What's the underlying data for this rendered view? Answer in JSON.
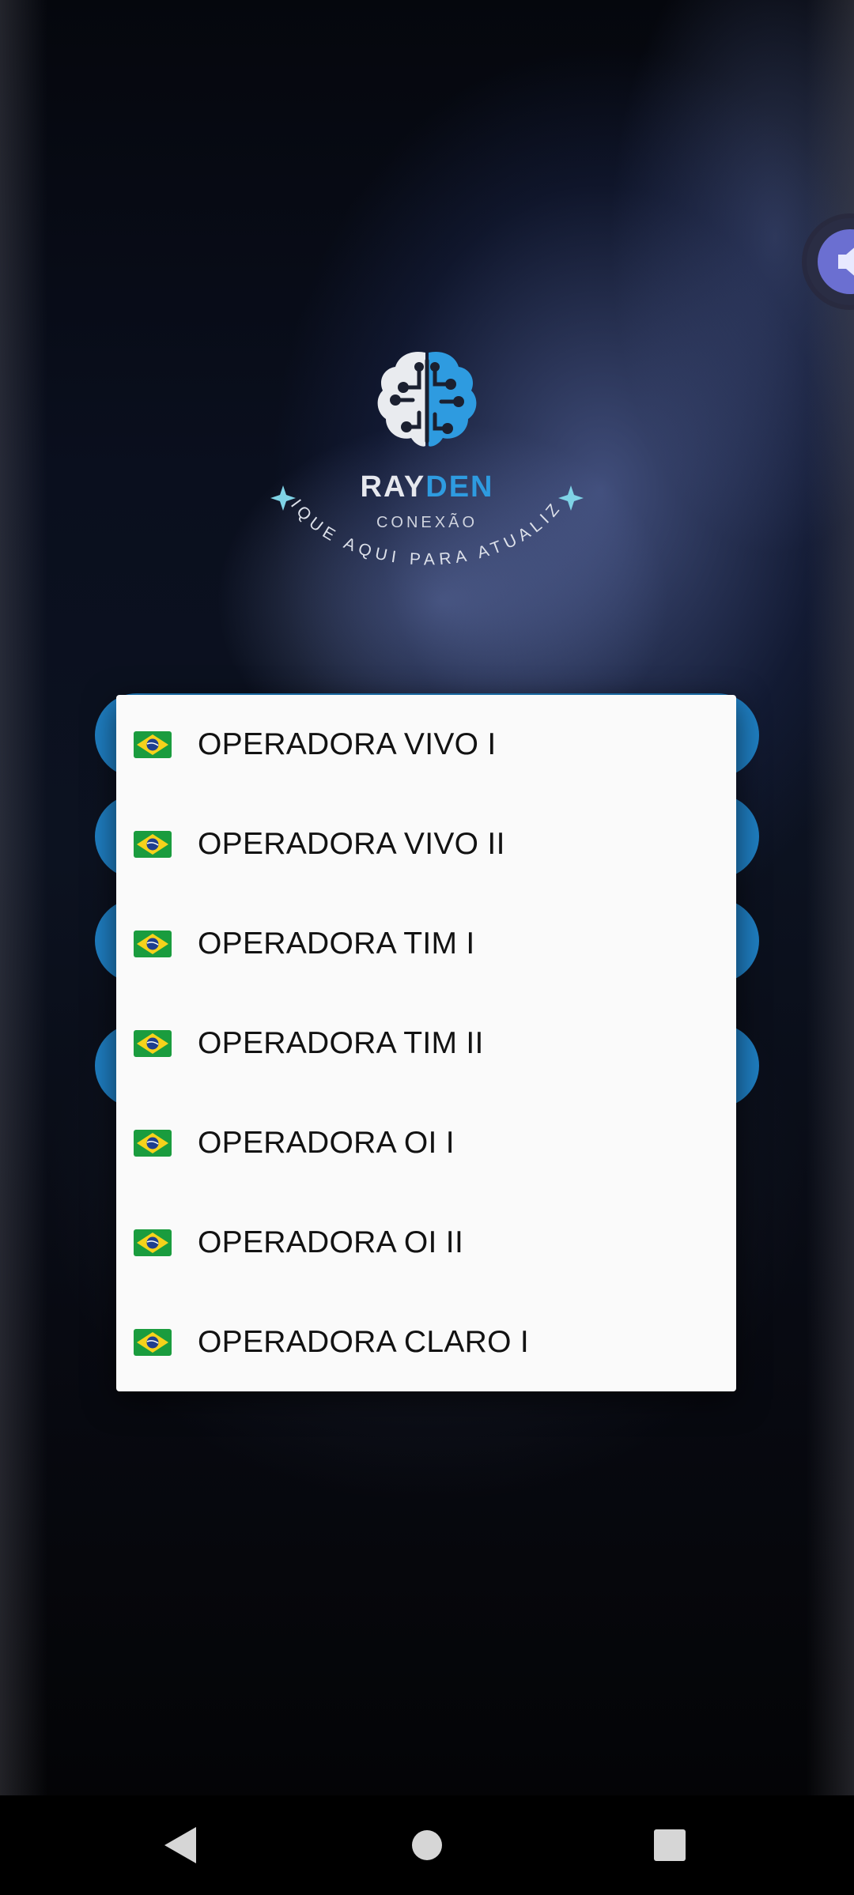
{
  "logo": {
    "title_part1": "RAY",
    "title_part2": "DEN",
    "subtitle": "CONEXÃO",
    "arc_text": "CLIQUE AQUI PARA ATUALIZAR"
  },
  "operators_dialog": {
    "items": [
      {
        "flag": "brazil-flag",
        "label": "OPERADORA VIVO I"
      },
      {
        "flag": "brazil-flag",
        "label": "OPERADORA VIVO II"
      },
      {
        "flag": "brazil-flag",
        "label": "OPERADORA TIM I"
      },
      {
        "flag": "brazil-flag",
        "label": "OPERADORA TIM II"
      },
      {
        "flag": "brazil-flag",
        "label": "OPERADORA OI I"
      },
      {
        "flag": "brazil-flag",
        "label": "OPERADORA OI II"
      },
      {
        "flag": "brazil-flag",
        "label": "OPERADORA CLARO I"
      }
    ]
  },
  "navbar": {
    "back": "back-icon",
    "home": "home-icon",
    "recents": "recents-icon"
  },
  "colors": {
    "accent_blue": "#1f7fc3",
    "logo_blue": "#2e9be0",
    "dialog_bg": "#fafafa",
    "fab_purple": "#6b6fd1"
  }
}
